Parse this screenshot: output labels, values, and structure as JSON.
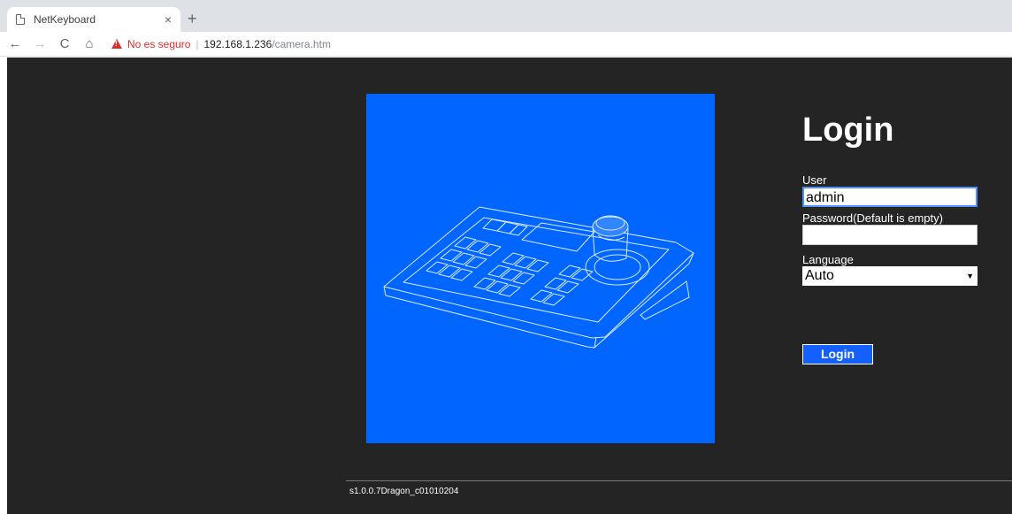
{
  "browser": {
    "tab_title": "NetKeyboard",
    "tab_close": "×",
    "new_tab": "+",
    "nav": {
      "back": "←",
      "forward": "→",
      "reload": "C",
      "home": "⌂"
    },
    "security_label": "No es seguro",
    "separator": "|",
    "url_host": "192.168.1.236",
    "url_path": "/camera.htm"
  },
  "login": {
    "title": "Login",
    "user_label": "User",
    "user_value": "admin",
    "password_label": "Password(Default is empty)",
    "password_value": "",
    "language_label": "Language",
    "language_value": "Auto",
    "language_caret": "▼",
    "submit_label": "Login"
  },
  "footer": {
    "version": "s1.0.0.7Dragon_c01010204"
  },
  "colors": {
    "page_bg": "#242424",
    "hero_bg": "#0066ff",
    "button_bg": "#1460ff",
    "warning": "#d93025"
  },
  "icons": [
    "page-icon",
    "close-icon",
    "plus-icon",
    "back-arrow-icon",
    "forward-arrow-icon",
    "reload-icon",
    "home-icon",
    "warning-icon",
    "keyboard-illustration",
    "chevron-down-icon"
  ]
}
